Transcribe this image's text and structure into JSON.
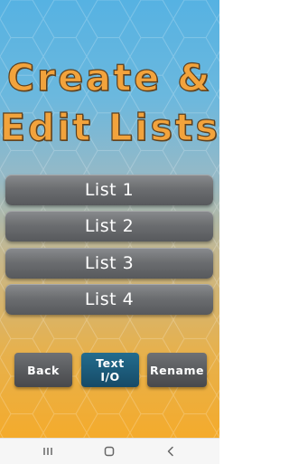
{
  "title": {
    "line1": "Create &",
    "line2": "Edit Lists"
  },
  "lists": [
    {
      "label": "List 1"
    },
    {
      "label": "List 2"
    },
    {
      "label": "List 3"
    },
    {
      "label": "List 4"
    }
  ],
  "actions": {
    "back_label": "Back",
    "text_io_line1": "Text",
    "text_io_line2": "I/O",
    "rename_label": "Rename"
  },
  "nav": {
    "icons": [
      "recents-icon",
      "home-icon",
      "back-icon"
    ]
  },
  "colors": {
    "title_fill": "#f2a33c",
    "title_outline": "#5a4021",
    "list_button": "#6c6e71",
    "text_io_button": "#1c5a79",
    "bg_top": "#56b2e2",
    "bg_bottom": "#f4ab2c"
  }
}
